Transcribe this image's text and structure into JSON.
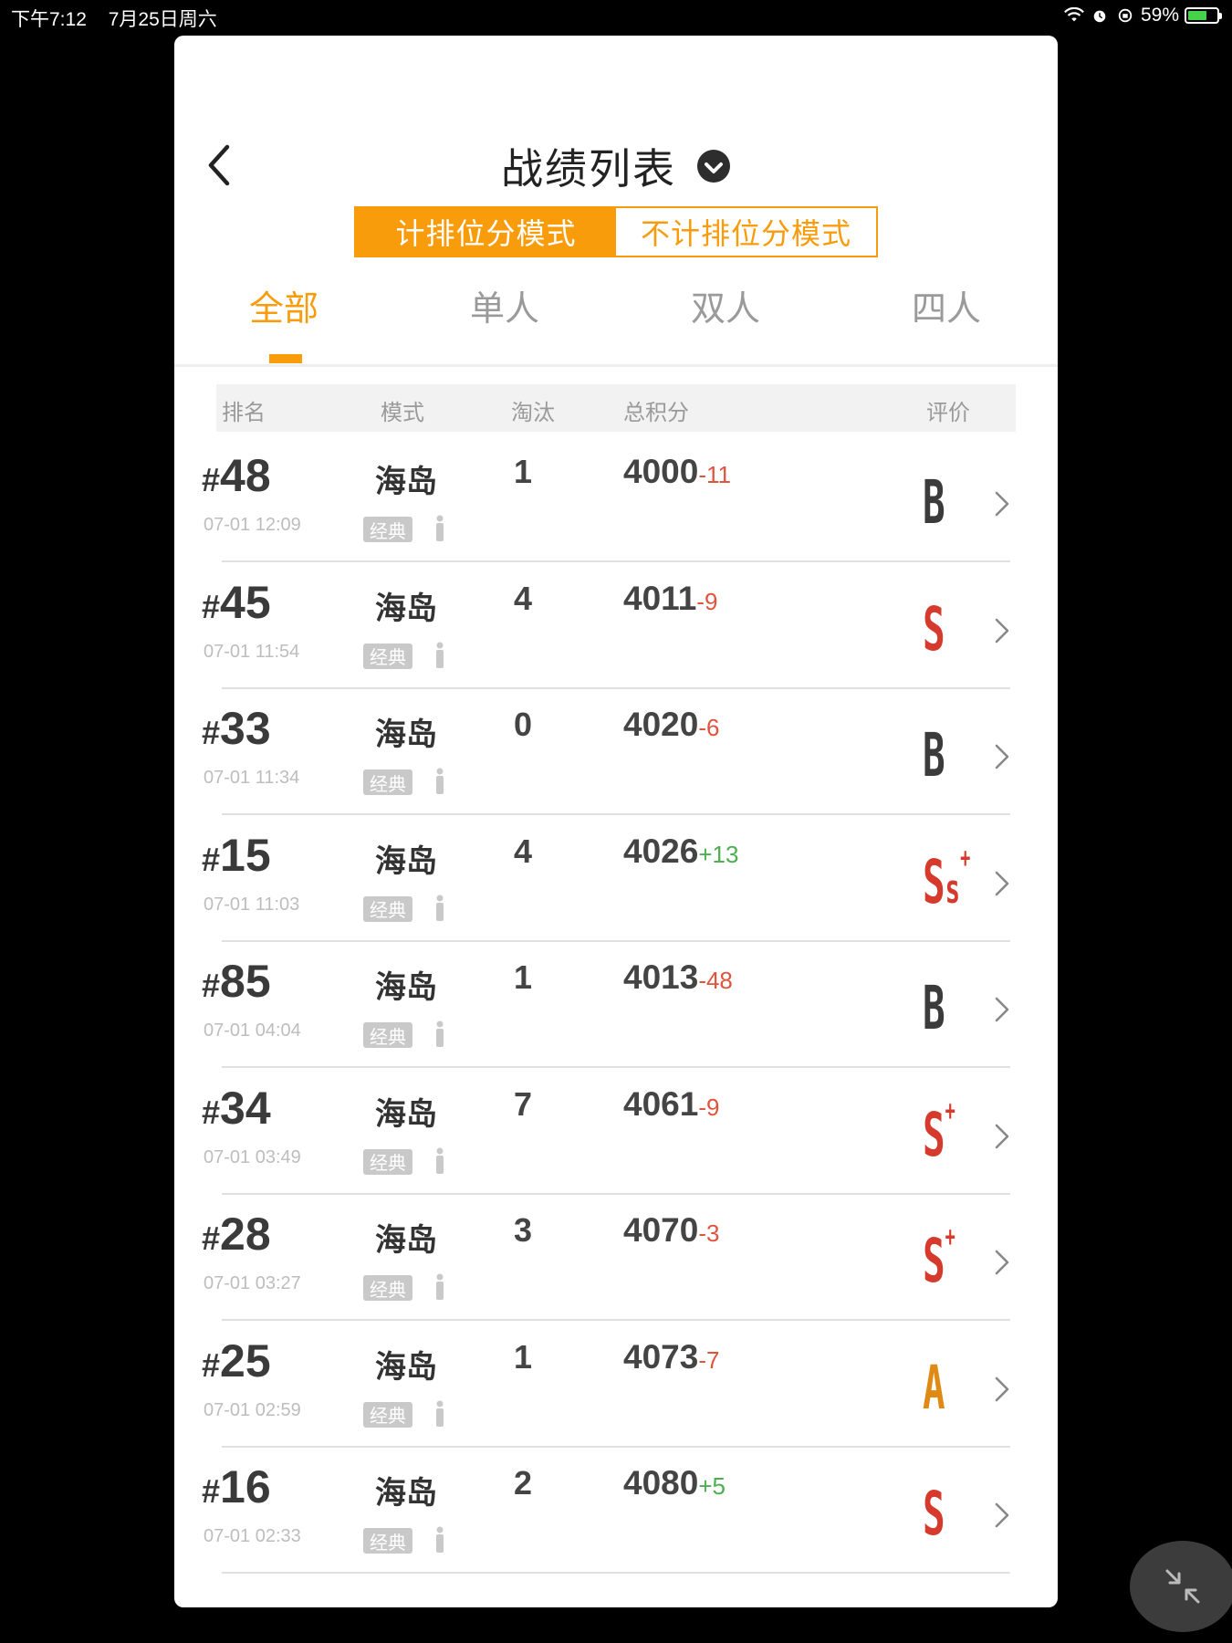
{
  "status_bar": {
    "time": "下午7:12",
    "date": "7月25日周六",
    "battery": "59%",
    "battery_level": 0.59
  },
  "header": {
    "title": "战绩列表"
  },
  "mode_toggle": {
    "options": [
      "计排位分模式",
      "不计排位分模式"
    ],
    "selected": "计排位分模式"
  },
  "tabs": {
    "items": [
      "全部",
      "单人",
      "双人",
      "四人"
    ],
    "selected": "全部"
  },
  "table": {
    "columns": [
      "排名",
      "模式",
      "淘汰",
      "总积分",
      "评价"
    ],
    "rows": [
      {
        "rank": "48",
        "time": "07-01 12:09",
        "map": "海岛",
        "tag": "经典",
        "kills": "1",
        "score": "4000",
        "delta": "-11",
        "grade": "B"
      },
      {
        "rank": "45",
        "time": "07-01 11:54",
        "map": "海岛",
        "tag": "经典",
        "kills": "4",
        "score": "4011",
        "delta": "-9",
        "grade": "S"
      },
      {
        "rank": "33",
        "time": "07-01 11:34",
        "map": "海岛",
        "tag": "经典",
        "kills": "0",
        "score": "4020",
        "delta": "-6",
        "grade": "B"
      },
      {
        "rank": "15",
        "time": "07-01 11:03",
        "map": "海岛",
        "tag": "经典",
        "kills": "4",
        "score": "4026",
        "delta": "+13",
        "grade": "SS+"
      },
      {
        "rank": "85",
        "time": "07-01 04:04",
        "map": "海岛",
        "tag": "经典",
        "kills": "1",
        "score": "4013",
        "delta": "-48",
        "grade": "B"
      },
      {
        "rank": "34",
        "time": "07-01 03:49",
        "map": "海岛",
        "tag": "经典",
        "kills": "7",
        "score": "4061",
        "delta": "-9",
        "grade": "S+"
      },
      {
        "rank": "28",
        "time": "07-01 03:27",
        "map": "海岛",
        "tag": "经典",
        "kills": "3",
        "score": "4070",
        "delta": "-3",
        "grade": "S+"
      },
      {
        "rank": "25",
        "time": "07-01 02:59",
        "map": "海岛",
        "tag": "经典",
        "kills": "1",
        "score": "4073",
        "delta": "-7",
        "grade": "A"
      },
      {
        "rank": "16",
        "time": "07-01 02:33",
        "map": "海岛",
        "tag": "经典",
        "kills": "2",
        "score": "4080",
        "delta": "+5",
        "grade": "S"
      }
    ]
  },
  "colors": {
    "accent": "#f89c0c",
    "negative": "#e0533d",
    "positive": "#4caf50"
  }
}
